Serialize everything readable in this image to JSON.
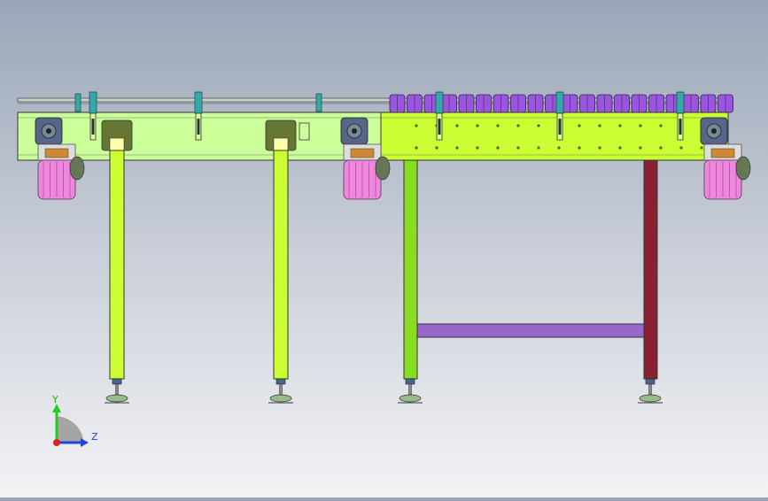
{
  "colors": {
    "frame_left": "#ccff99",
    "frame_right": "#ccff33",
    "leg_left": "#ccff33",
    "leg_mid": "#88dd22",
    "leg_dark": "#882233",
    "crossbar": "#9966cc",
    "rollers": "#9955dd",
    "motor_body": "#ee88dd",
    "gearbox": "#556688",
    "bracket": "#33aaaa",
    "axis_y": "#22cc22",
    "axis_z": "#2244dd",
    "axis_origin": "#dd2222"
  },
  "triad": {
    "y_label": "Y",
    "z_label": "Z"
  }
}
